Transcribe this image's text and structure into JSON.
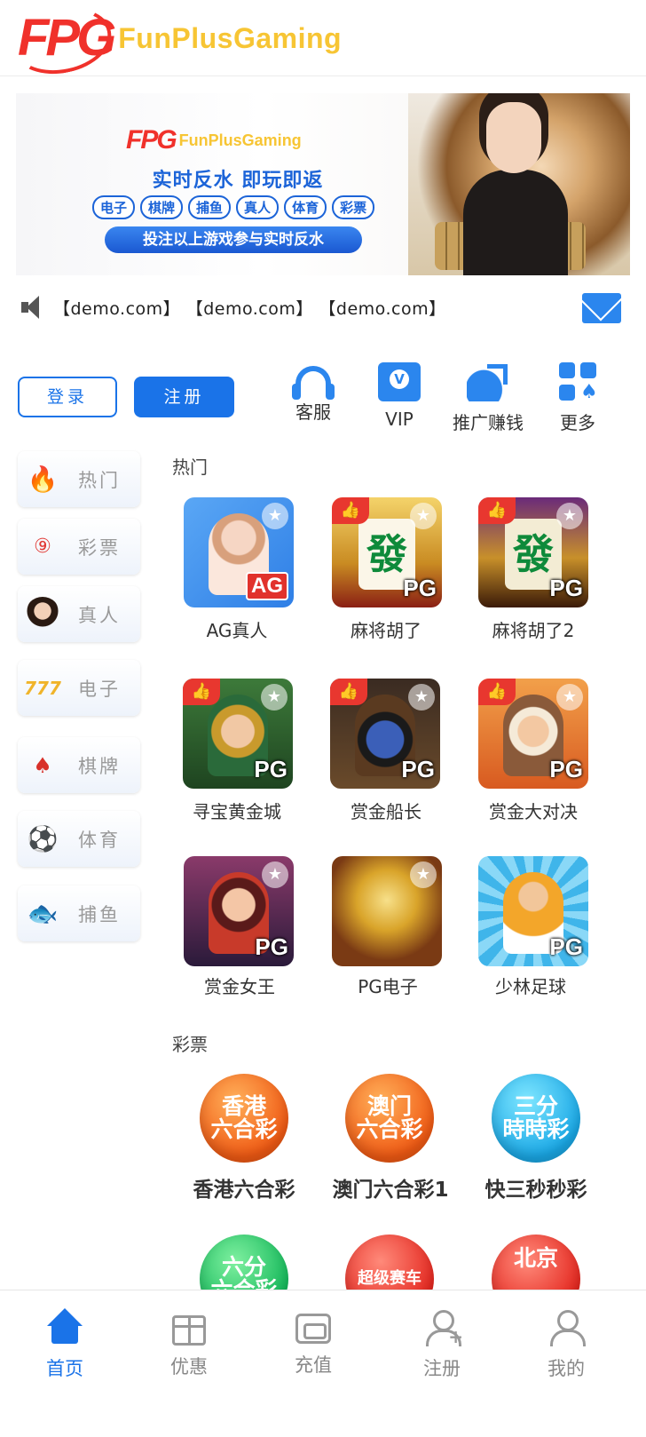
{
  "header": {
    "logo_mark": "FPG",
    "logo_text": "FunPlusGaming"
  },
  "banner": {
    "logo_mark": "FPG",
    "logo_text": "FunPlusGaming",
    "slogan": "实时反水  即玩即返",
    "tags": [
      "电子",
      "棋牌",
      "捕鱼",
      "真人",
      "体育",
      "彩票"
    ],
    "note": "投注以上游戏参与实时反水"
  },
  "notice": {
    "text": "【demo.com】 【demo.com】 【demo.com】"
  },
  "auth": {
    "login_label": "登录",
    "register_label": "注册"
  },
  "quick_actions": [
    {
      "label": "客服",
      "icon": "headset-icon"
    },
    {
      "label": "VIP",
      "icon": "vip-icon"
    },
    {
      "label": "推广赚钱",
      "icon": "coins-icon"
    },
    {
      "label": "更多",
      "icon": "more-grid-icon"
    }
  ],
  "categories": [
    {
      "label": "热门",
      "icon": "fire-icon"
    },
    {
      "label": "彩票",
      "icon": "lottery-ball-icon"
    },
    {
      "label": "真人",
      "icon": "live-dealer-icon"
    },
    {
      "label": "电子",
      "icon": "slot-777-icon"
    },
    {
      "label": "棋牌",
      "icon": "cards-icon"
    },
    {
      "label": "体育",
      "icon": "soccer-ball-icon"
    },
    {
      "label": "捕鱼",
      "icon": "fish-icon"
    }
  ],
  "hot_section": {
    "title": "热门",
    "games": [
      {
        "name": "AG真人",
        "brand": "AG"
      },
      {
        "name": "麻将胡了",
        "brand": "PG",
        "tile_text": "發"
      },
      {
        "name": "麻将胡了2",
        "brand": "PG",
        "tile_text": "發"
      },
      {
        "name": "寻宝黄金城",
        "brand": "PG"
      },
      {
        "name": "赏金船长",
        "brand": "PG"
      },
      {
        "name": "赏金大对决",
        "brand": "PG"
      },
      {
        "name": "赏金女王",
        "brand": "PG"
      },
      {
        "name": "PG电子",
        "brand": ""
      },
      {
        "name": "少林足球",
        "brand": "PG"
      }
    ]
  },
  "lottery_section": {
    "title": "彩票",
    "games": [
      {
        "name": "香港六合彩",
        "icon_text": "香港\n六合彩"
      },
      {
        "name": "澳门六合彩1",
        "icon_text": "澳门\n六合彩"
      },
      {
        "name": "快三秒秒彩",
        "icon_text": "三分\n時時彩"
      },
      {
        "name": "",
        "icon_text": "六分\n六合彩"
      },
      {
        "name": "",
        "icon_text": "超级赛车"
      },
      {
        "name": "",
        "icon_text": "北京"
      }
    ]
  },
  "bottom_nav": [
    {
      "label": "首页",
      "icon": "home-icon",
      "active": true
    },
    {
      "label": "优惠",
      "icon": "gift-icon",
      "active": false
    },
    {
      "label": "充值",
      "icon": "wallet-icon",
      "active": false
    },
    {
      "label": "注册",
      "icon": "user-add-icon",
      "active": false
    },
    {
      "label": "我的",
      "icon": "user-icon",
      "active": false
    }
  ],
  "colors": {
    "accent": "#1a73e8",
    "hot_badge": "#e8372f",
    "logo_red": "#f0312b",
    "logo_gold": "#f7c534"
  }
}
